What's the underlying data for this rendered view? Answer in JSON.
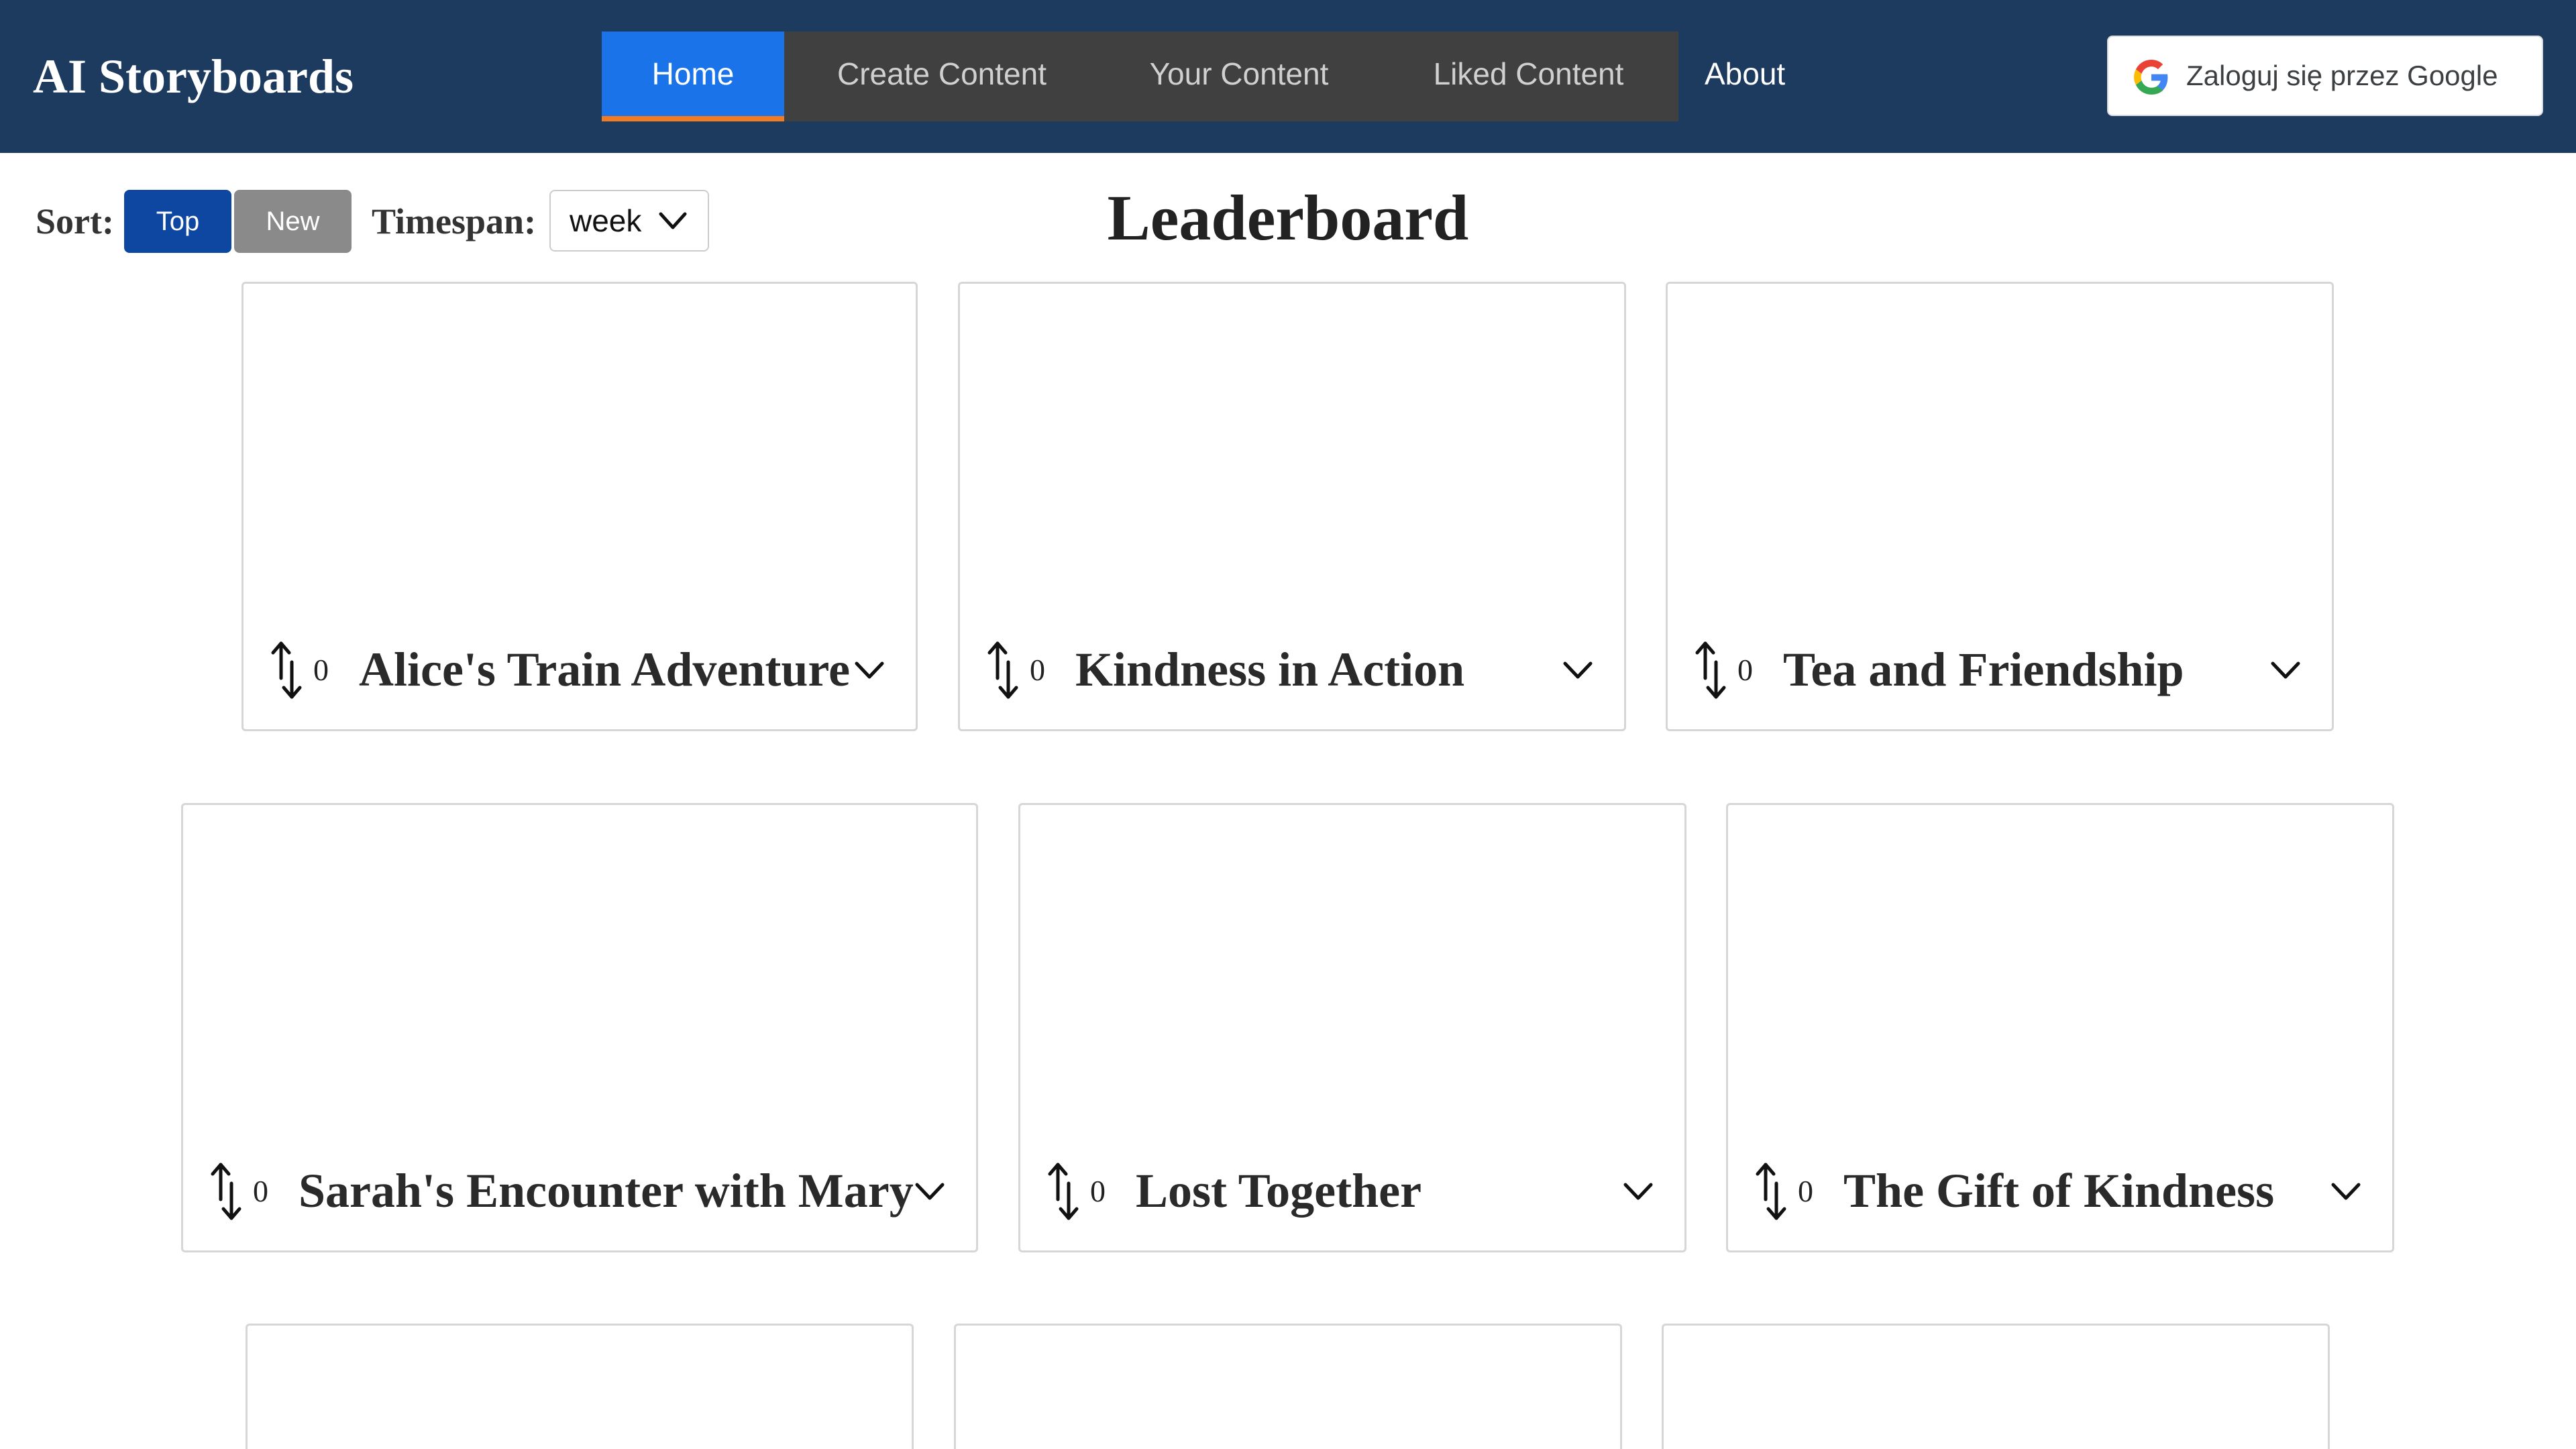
{
  "header": {
    "brand": "AI Storyboards",
    "nav": [
      {
        "label": "Home",
        "active": true
      },
      {
        "label": "Create Content",
        "active": false
      },
      {
        "label": "Your Content",
        "active": false
      },
      {
        "label": "Liked Content",
        "active": false
      }
    ],
    "about_label": "About",
    "google_signin_label": "Zaloguj się przez Google"
  },
  "controls": {
    "sort_label": "Sort:",
    "sort_options": [
      "Top",
      "New"
    ],
    "sort_selected": "Top",
    "timespan_label": "Timespan:",
    "timespan_value": "week"
  },
  "page_title": "Leaderboard",
  "cards": [
    {
      "votes": "0",
      "title": "Alice's Train Adventure"
    },
    {
      "votes": "0",
      "title": "Kindness in Action"
    },
    {
      "votes": "0",
      "title": "Tea and Friendship"
    },
    {
      "votes": "0",
      "title": "Sarah's Encounter with Mary"
    },
    {
      "votes": "0",
      "title": "Lost Together"
    },
    {
      "votes": "0",
      "title": "The Gift of Kindness"
    }
  ],
  "icons": {
    "vote": "up-down-arrow-icon",
    "expand": "chevron-down-icon",
    "google": "google-logo-icon"
  },
  "colors": {
    "navbar_bg": "#1d3a5f",
    "nav_group_bg": "#404040",
    "nav_active_bg": "#1a73e8",
    "nav_active_underline": "#f07b22",
    "sort_top_bg": "#0d47a1",
    "sort_new_bg": "#8a8a8a"
  }
}
